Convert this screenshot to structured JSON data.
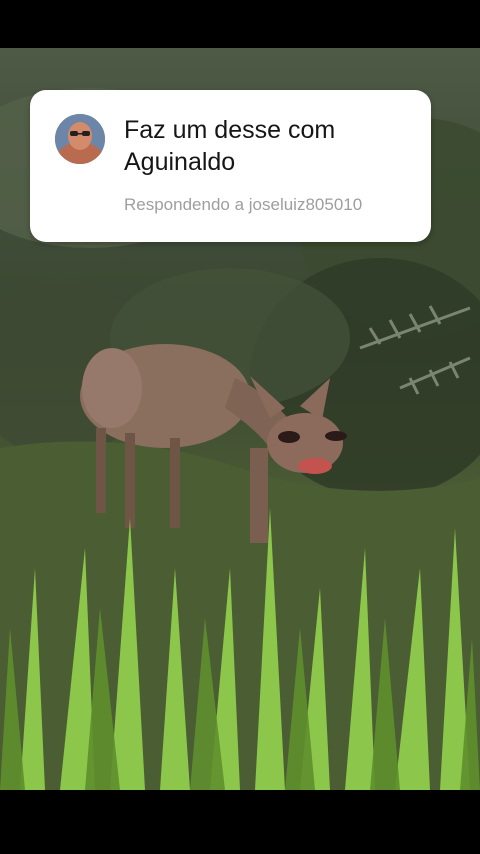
{
  "reply_card": {
    "comment_text": "Faz um desse com Aguinaldo",
    "replying_to": "Respondendo a joseluiz805010",
    "avatar_icon": "user-avatar-photo"
  },
  "video": {
    "subject": "deer-with-edited-human-face"
  }
}
